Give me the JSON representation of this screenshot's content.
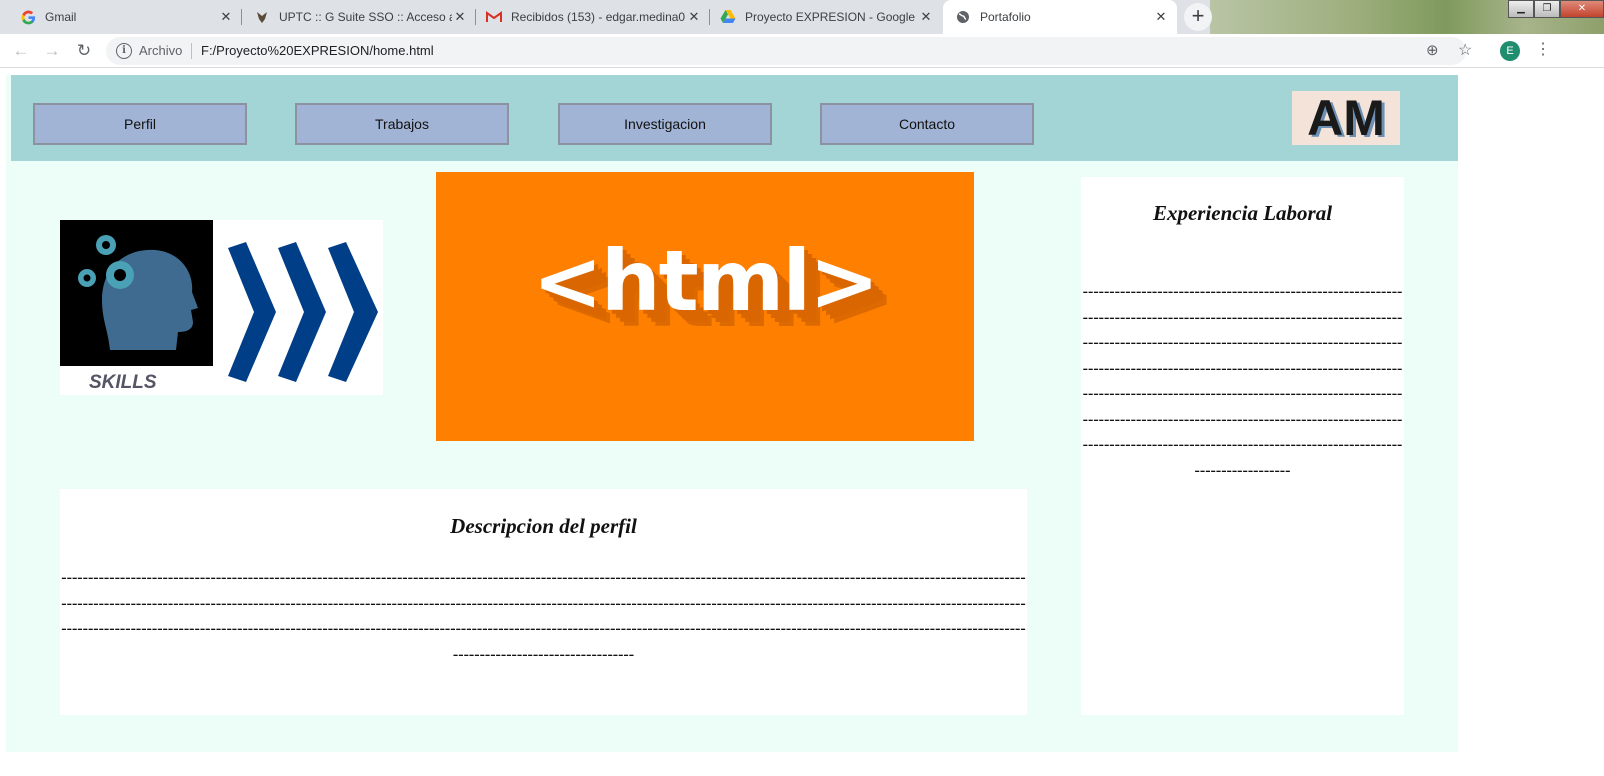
{
  "browser": {
    "tabs": [
      {
        "title": "Gmail",
        "favicon": "google-g-icon"
      },
      {
        "title": "UPTC :: G Suite SSO :: Acceso a G",
        "favicon": "uptc-shield-icon"
      },
      {
        "title": "Recibidos (153) - edgar.medina0",
        "favicon": "gmail-m-icon"
      },
      {
        "title": "Proyecto EXPRESION - Google D",
        "favicon": "google-drive-icon"
      },
      {
        "title": "Portafolio",
        "favicon": "globe-icon"
      }
    ],
    "close_glyph": "✕",
    "new_tab_glyph": "+",
    "omnibox": {
      "scheme_label": "Archivo",
      "url": "F:/Proyecto%20EXPRESION/home.html"
    },
    "profile_initial": "E"
  },
  "colors": {
    "nav_band": "#a4d5d6",
    "nav_button": "#a2b4d5",
    "page_background": "#edfdf7",
    "html_banner": "#ff7f00",
    "accent_blue": "#003f87"
  },
  "nav": {
    "links": [
      "Perfil",
      "Trabajos",
      "Investigacion",
      "Contacto"
    ],
    "logo_text": "AM"
  },
  "skills_image": {
    "label": "SKILLS"
  },
  "html_banner": {
    "text": "<html>"
  },
  "profile": {
    "title": "Descripcion del perfil",
    "body": "-------------------------------------------------------------------------------------------------------------------------------------------------------------------------------------------------------------------------------------------------------------------------------------------------------------------------------------------------------------------------------------------------------------------------------------------------------------------------------------------------------------------------------------------------------------------------------------------------"
  },
  "experience": {
    "title": "Experiencia Laboral",
    "body": "------------------------------------------------------------------------------------------------------------------------------------------------------------------------------------------------------------------------------------------------------------------------------------------------------------------------------------------------------------------------------------------------------------------------------------------------------"
  }
}
